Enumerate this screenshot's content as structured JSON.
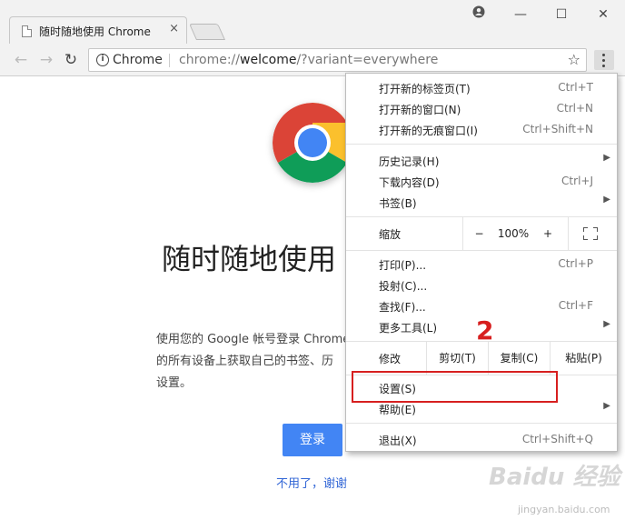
{
  "tab": {
    "title": "随时随地使用 Chrome",
    "close": "×"
  },
  "window": {
    "minimize": "—",
    "maximize": "☐",
    "close": "✕"
  },
  "toolbar": {
    "back": "←",
    "forward": "→",
    "reload": "↻",
    "omnibox_chip": "Chrome",
    "url_scheme": "chrome://",
    "url_host": "welcome",
    "url_path": "/?variant=everywhere",
    "star": "☆"
  },
  "page": {
    "headline": "随时随地使用",
    "desc_line1": "使用您的 Google 帐号登录 Chrome",
    "desc_line2": "的所有设备上获取自己的书签、历",
    "desc_line3": "设置。",
    "signin_button": "登录",
    "no_thanks": "不用了，谢谢"
  },
  "menu": {
    "group1": [
      {
        "label": "打开新的标签页(T)",
        "shortcut": "Ctrl+T"
      },
      {
        "label": "打开新的窗口(N)",
        "shortcut": "Ctrl+N"
      },
      {
        "label": "打开新的无痕窗口(I)",
        "shortcut": "Ctrl+Shift+N"
      }
    ],
    "group2": [
      {
        "label": "历史记录(H)",
        "shortcut": ""
      },
      {
        "label": "下载内容(D)",
        "shortcut": "Ctrl+J"
      },
      {
        "label": "书签(B)",
        "shortcut": ""
      }
    ],
    "zoom": {
      "label": "缩放",
      "minus": "−",
      "value": "100%",
      "plus": "+"
    },
    "group3": [
      {
        "label": "打印(P)...",
        "shortcut": "Ctrl+P"
      },
      {
        "label": "投射(C)...",
        "shortcut": ""
      },
      {
        "label": "查找(F)...",
        "shortcut": "Ctrl+F"
      },
      {
        "label": "更多工具(L)",
        "shortcut": ""
      }
    ],
    "edit": {
      "label": "修改",
      "cut": "剪切(T)",
      "copy": "复制(C)",
      "paste": "粘贴(P)"
    },
    "group4": [
      {
        "label": "设置(S)",
        "shortcut": ""
      },
      {
        "label": "帮助(E)",
        "shortcut": ""
      }
    ],
    "exit": {
      "label": "退出(X)",
      "shortcut": "Ctrl+Shift+Q"
    },
    "submenu_arrow": "▶"
  },
  "annotation": {
    "number": "2"
  },
  "watermark": {
    "logo": "Baidu 经验",
    "url": "jingyan.baidu.com"
  },
  "colors": {
    "accent": "#4285f4",
    "annotation": "#d71f1f"
  }
}
